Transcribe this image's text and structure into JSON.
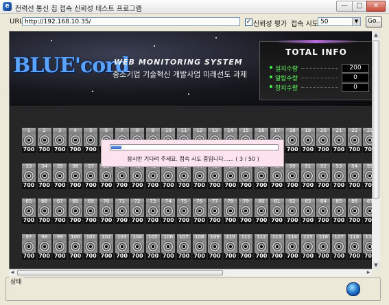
{
  "window": {
    "title": "전력선 통신 칩 접속 신뢰성 테스트 프로그램",
    "buttons": [
      "—",
      "□",
      "✕"
    ]
  },
  "toolbar": {
    "url_label": "URL",
    "url_value": "http://192.168.10.35/",
    "reliability_label": "신뢰성 평가",
    "reliability_checked": "✓",
    "attempts_label": "접속 시도",
    "attempts_value": "50",
    "go_label": "Go.."
  },
  "banner": {
    "logo": "BLUE'cord",
    "subtitle": "WEB MONITORING SYSTEM",
    "project": "중소기업 기술혁신 개발사업 미래선도 과제"
  },
  "total_info": {
    "title": "TOTAL INFO",
    "rows": [
      {
        "label": "설치수량",
        "value": "200"
      },
      {
        "label": "알람수량",
        "value": "0"
      },
      {
        "label": "장치수량",
        "value": "0"
      }
    ]
  },
  "devices": {
    "value": "700",
    "rows": [
      {
        "start": 1,
        "end": 23
      },
      {
        "start": 33,
        "end": 55
      },
      {
        "start": 65,
        "end": 87
      },
      {
        "start": 97,
        "end": 119
      }
    ]
  },
  "dialog": {
    "message": "잠시만 기다려 주세요. 접속 시도 중입니다...... ( 3 / 50 )",
    "progress": 0.06
  },
  "status": {
    "label": "상태"
  }
}
